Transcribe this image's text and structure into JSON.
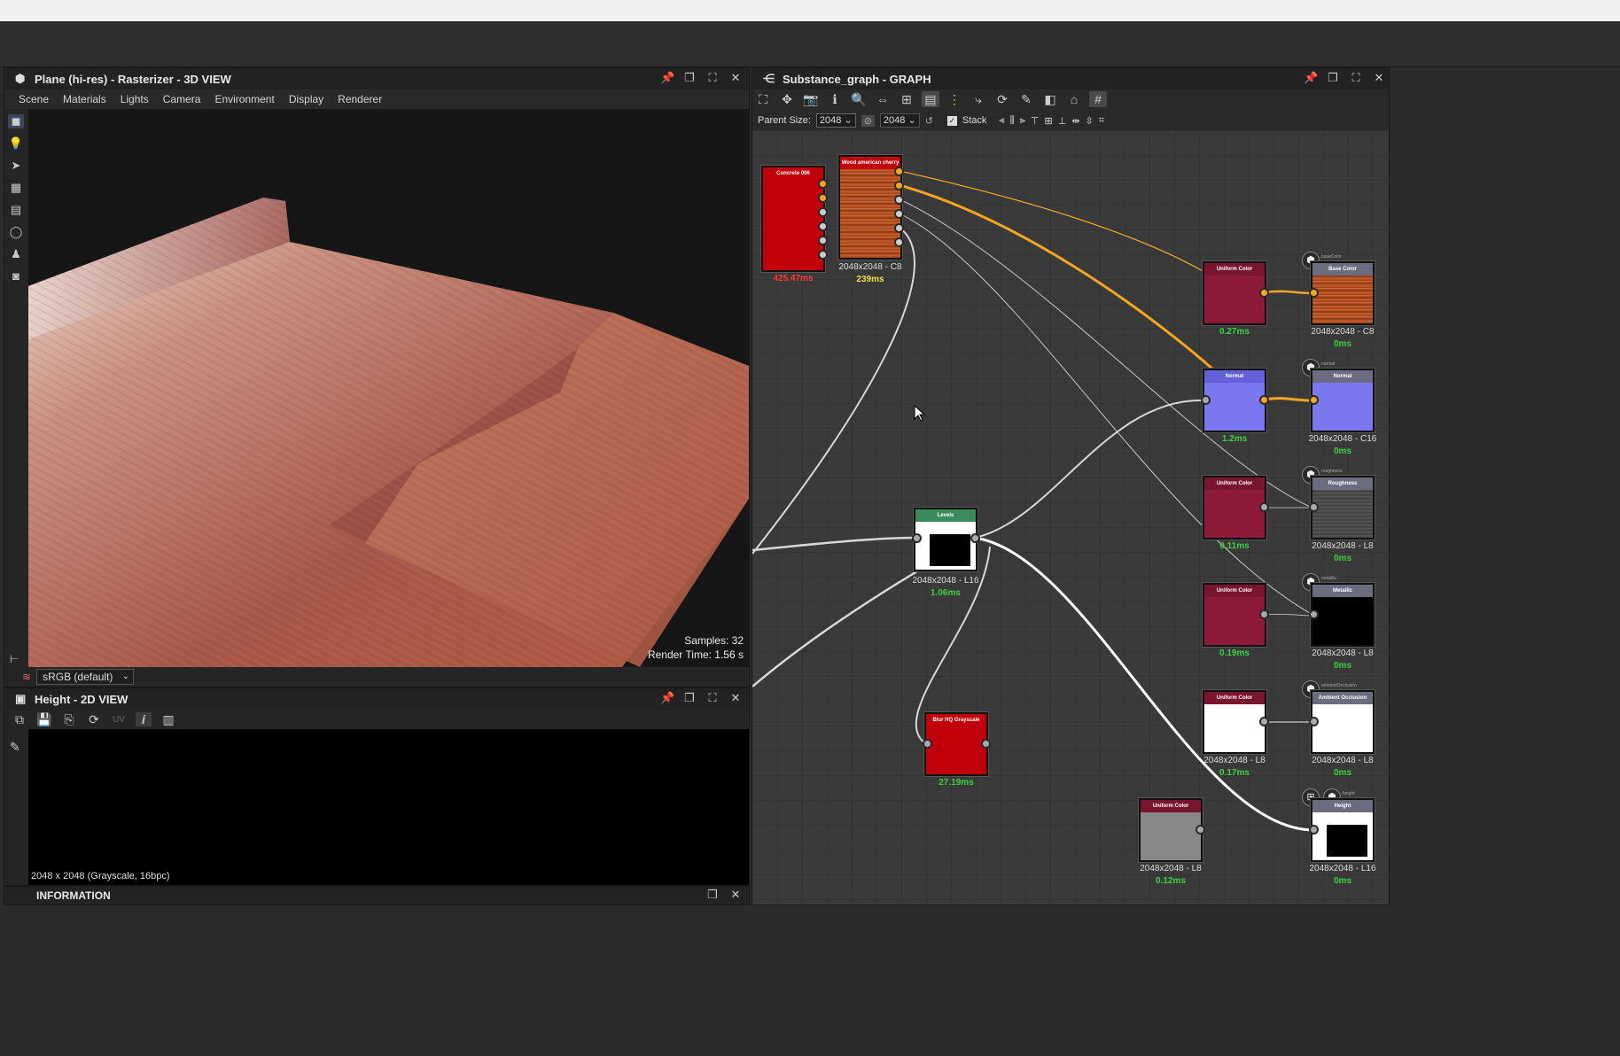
{
  "view3d": {
    "title": "Plane (hi-res) - Rasterizer - 3D VIEW",
    "menu": [
      "Scene",
      "Materials",
      "Lights",
      "Camera",
      "Environment",
      "Display",
      "Renderer"
    ],
    "samples": "Samples: 32",
    "render_time": "Render Time: 1.56 s",
    "colorspace": "sRGB (default)"
  },
  "view2d": {
    "title": "Height - 2D VIEW",
    "uv_label": "UV",
    "info": "2048 x 2048 (Grayscale, 16bpc)"
  },
  "information": {
    "title": "INFORMATION"
  },
  "graph": {
    "title": "Substance_graph - GRAPH",
    "parent_size_label": "Parent Size:",
    "parent_size": "2048",
    "size2": "2048",
    "stack_label": "Stack",
    "nodes": {
      "concrete": {
        "title": "Concrete 006",
        "time": "425.47ms"
      },
      "wood": {
        "title": "Wood american cherry",
        "size": "2048x2048 - C8",
        "time": "239ms"
      },
      "uc1": {
        "title": "Uniform Color",
        "time": "0.27ms"
      },
      "basecolor": {
        "title": "Base Color",
        "out": "baseColor",
        "size": "2048x2048 - C8",
        "time": "0ms"
      },
      "normal1": {
        "title": "Normal",
        "time": "1.2ms"
      },
      "normal_out": {
        "title": "Normal",
        "out": "normal",
        "size": "2048x2048 - C16",
        "time": "0ms"
      },
      "uc2": {
        "title": "Uniform Color",
        "time": "0.11ms"
      },
      "roughness": {
        "title": "Roughness",
        "out": "roughness",
        "size": "2048x2048 - L8",
        "time": "0ms"
      },
      "levels": {
        "title": "Levels",
        "size": "2048x2048 - L16",
        "time": "1.06ms"
      },
      "uc3": {
        "title": "Uniform Color",
        "time": "0.19ms"
      },
      "metallic": {
        "title": "Metallic",
        "out": "metallic",
        "size": "2048x2048 - L8",
        "time": "0ms"
      },
      "uc4": {
        "title": "Uniform Color",
        "size": "2048x2048 - L8",
        "time": "0.17ms"
      },
      "ao": {
        "title": "Ambient Occlusion",
        "out": "ambientOcclusion",
        "size": "2048x2048 - L8",
        "time": "0ms"
      },
      "blur": {
        "title": "Blur HQ Grayscale",
        "time": "27.19ms"
      },
      "uc5": {
        "title": "Uniform Color",
        "size": "2048x2048 - L8",
        "time": "0.12ms"
      },
      "height": {
        "title": "Height",
        "out": "height",
        "size": "2048x2048 - L16",
        "time": "0ms"
      }
    }
  },
  "colors": {
    "node_red": "#c0000a",
    "uniform_magenta": "#8e1a3a",
    "normal_purple": "#7b78ef",
    "wire_orange": "#f5a623",
    "time_green": "#3cd43c",
    "time_yellow": "#f2e34b",
    "time_red": "#ff3b3b"
  }
}
